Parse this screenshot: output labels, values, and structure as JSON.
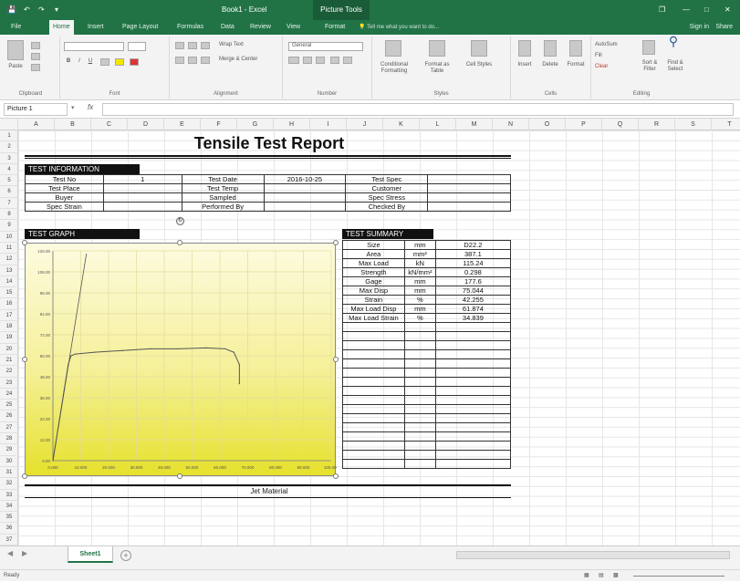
{
  "window": {
    "title": "Book1 - Excel",
    "context_tab": "Picture Tools",
    "controls": [
      "restore-icon",
      "minimize-icon",
      "maximize-icon",
      "close-icon"
    ]
  },
  "ribbon_tabs": [
    "File",
    "Home",
    "Insert",
    "Page Layout",
    "Formulas",
    "Data",
    "Review",
    "View",
    "Format"
  ],
  "active_tab": "Home",
  "tell_me": "Tell me what you want to do...",
  "account": {
    "sign_in": "Sign in",
    "share": "Share"
  },
  "ribbon": {
    "groups": [
      "Clipboard",
      "Font",
      "Alignment",
      "Number",
      "Styles",
      "Cells",
      "Editing"
    ],
    "clipboard": {
      "paste": "Paste"
    },
    "alignment": {
      "wrap_text": "Wrap Text",
      "merge_center": "Merge & Center"
    },
    "number": {
      "format": "General"
    },
    "styles": {
      "conditional": "Conditional Formatting",
      "format_table": "Format as Table",
      "cell_styles": "Cell Styles"
    },
    "cells": {
      "insert": "Insert",
      "delete": "Delete",
      "format": "Format"
    },
    "editing": {
      "autosum": "AutoSum",
      "fill": "Fill",
      "clear": "Clear",
      "sort_filter": "Sort & Filter",
      "find_select": "Find & Select"
    }
  },
  "formula_bar": {
    "name_box": "Picture 1",
    "fx": "fx",
    "value": ""
  },
  "columns": [
    "A",
    "B",
    "C",
    "D",
    "E",
    "F",
    "G",
    "H",
    "I",
    "J",
    "K",
    "L",
    "M",
    "N",
    "O",
    "P",
    "Q",
    "R",
    "S",
    "T"
  ],
  "rows": [
    "1",
    "2",
    "3",
    "4",
    "5",
    "6",
    "7",
    "8",
    "9",
    "10",
    "11",
    "12",
    "13",
    "14",
    "15",
    "16",
    "17",
    "18",
    "19",
    "20",
    "21",
    "22",
    "23",
    "24",
    "25",
    "26",
    "27",
    "28",
    "29",
    "30",
    "31",
    "32",
    "33",
    "34",
    "35",
    "36",
    "37"
  ],
  "report": {
    "title": "Tensile Test Report",
    "test_information_header": "TEST INFORMATION",
    "info_rows": [
      [
        "Test No",
        "1",
        "Test Date",
        "2016-10-25",
        "Test Spec",
        ""
      ],
      [
        "Test Place",
        "",
        "Test Temp",
        "",
        "Customer",
        ""
      ],
      [
        "Buyer",
        "",
        "Sampled",
        "",
        "Spec Stress",
        ""
      ],
      [
        "Spec Strain",
        "",
        "Performed By",
        "",
        "Checked By",
        ""
      ]
    ],
    "test_graph_header": "TEST GRAPH",
    "test_summary_header": "TEST SUMMARY",
    "summary_rows": [
      [
        "Size",
        "mm",
        "D22.2"
      ],
      [
        "Area",
        "mm²",
        "387.1"
      ],
      [
        "Max Load",
        "kN",
        "115.24"
      ],
      [
        "Strength",
        "kN/mm²",
        "0.298"
      ],
      [
        "Gage",
        "mm",
        "177.6"
      ],
      [
        "Max Disp",
        "mm",
        "75.044"
      ],
      [
        "Strain",
        "%",
        "42.255"
      ],
      [
        "Max Load Disp",
        "mm",
        "61.874"
      ],
      [
        "Max Load Strain",
        "%",
        "34.839"
      ],
      [
        "",
        "",
        ""
      ],
      [
        "",
        "",
        ""
      ],
      [
        "",
        "",
        ""
      ],
      [
        "",
        "",
        ""
      ],
      [
        "",
        "",
        ""
      ],
      [
        "",
        "",
        ""
      ],
      [
        "",
        "",
        ""
      ],
      [
        "",
        "",
        ""
      ],
      [
        "",
        "",
        ""
      ],
      [
        "",
        "",
        ""
      ],
      [
        "",
        "",
        ""
      ],
      [
        "",
        "",
        ""
      ],
      [
        "",
        "",
        ""
      ],
      [
        "",
        "",
        ""
      ],
      [
        "",
        "",
        ""
      ],
      [
        "",
        "",
        ""
      ]
    ],
    "footer_caption": "Jet Material"
  },
  "chart_data": {
    "type": "line",
    "title": "",
    "xlabel": "",
    "ylabel": "",
    "y_ticks": [
      "0.00",
      "12.00",
      "24.00",
      "36.00",
      "48.00",
      "60.00",
      "72.00",
      "84.00",
      "96.00",
      "108.00",
      "120.00"
    ],
    "x_ticks": [
      "0.000",
      "10.000",
      "20.000",
      "30.000",
      "40.000",
      "50.000",
      "60.000",
      "70.000",
      "80.000",
      "90.000",
      "100.000"
    ],
    "ylim": [
      0,
      120
    ],
    "xlim": [
      0,
      100
    ],
    "grid": true,
    "series": [
      {
        "values": [
          [
            0,
            0
          ],
          [
            2,
            20
          ],
          [
            4,
            40
          ],
          [
            5.5,
            55
          ],
          [
            6.5,
            60
          ],
          [
            8,
            61
          ],
          [
            15,
            62
          ],
          [
            25,
            63
          ],
          [
            35,
            64
          ],
          [
            45,
            64
          ],
          [
            55,
            64.5
          ],
          [
            61.9,
            64
          ],
          [
            65,
            62
          ],
          [
            67,
            55
          ],
          [
            67,
            44
          ]
        ]
      },
      {
        "values": [
          [
            0,
            0
          ],
          [
            12,
            118
          ]
        ]
      }
    ],
    "colors": {
      "curve": "#555555",
      "background_top": "#fdfbe0",
      "background_bottom": "#e6e12c"
    }
  },
  "sheet_tabs": [
    "Sheet1"
  ],
  "status": {
    "ready": "Ready"
  }
}
